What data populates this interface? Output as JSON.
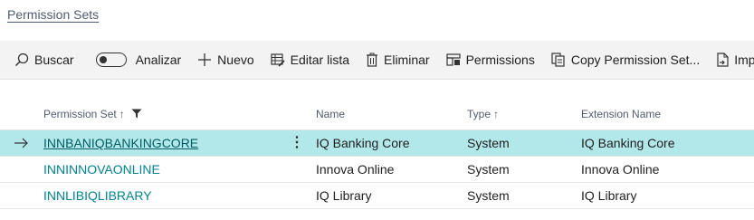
{
  "breadcrumb": {
    "label": "Permission Sets"
  },
  "actions": {
    "search": "Buscar",
    "analyze": "Analizar",
    "new": "Nuevo",
    "edit_list": "Editar lista",
    "delete": "Eliminar",
    "permissions": "Permissions",
    "copy": "Copy Permission Set...",
    "import": "Import P"
  },
  "columns": {
    "permission_set": "Permission Set",
    "name": "Name",
    "type": "Type",
    "extension_name": "Extension Name",
    "sort_indicator": "↑"
  },
  "rows": [
    {
      "permission_set": "INNBANIQBANKINGCORE",
      "name": "IQ Banking Core",
      "type": "System",
      "extension_name": "IQ Banking Core"
    },
    {
      "permission_set": "INNINNOVAONLINE",
      "name": "Innova Online",
      "type": "System",
      "extension_name": "Innova Online"
    },
    {
      "permission_set": "INNLIBIQLIBRARY",
      "name": "IQ Library",
      "type": "System",
      "extension_name": "IQ Library"
    }
  ],
  "colors": {
    "selected_row": "#b3e8ea",
    "link": "#00838f",
    "accent": "#005c63"
  }
}
